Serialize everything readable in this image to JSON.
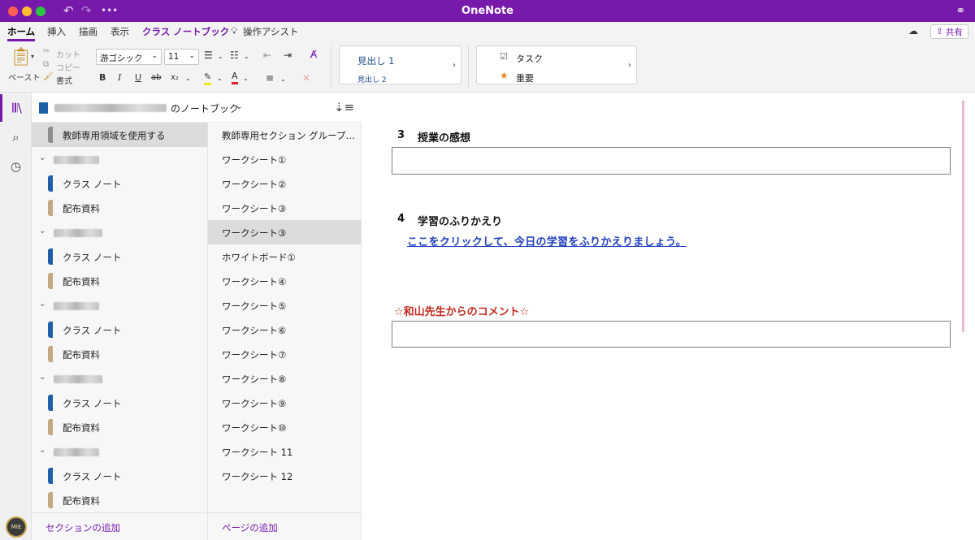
{
  "window": {
    "title": "OneNote"
  },
  "menu_tabs": [
    {
      "label": "ホーム"
    },
    {
      "label": "挿入"
    },
    {
      "label": "描画"
    },
    {
      "label": "表示"
    },
    {
      "label": "クラス ノートブック"
    },
    {
      "label": "操作アシスト"
    }
  ],
  "share": {
    "label": "共有"
  },
  "ribbon": {
    "paste_label": "ペースト",
    "cut_label": "カット",
    "copy_label": "コピー",
    "format_label": "書式",
    "font_name": "游ゴシック",
    "font_size": "11",
    "bold": "B",
    "italic": "I",
    "underline": "U",
    "strike": "ab",
    "subscript": "x₂",
    "styles": {
      "heading1": "見出し 1",
      "heading2": "見出し 2"
    },
    "tags": {
      "task": "タスク",
      "important": "重要"
    }
  },
  "notebook": {
    "title_suffix": "のノートブック"
  },
  "sections": [
    {
      "label": "教師専用領域を使用する",
      "kind": "gray",
      "type": "section",
      "selected": true
    },
    {
      "label": "",
      "type": "group"
    },
    {
      "label": "クラス ノート",
      "kind": "blue",
      "type": "section"
    },
    {
      "label": "配布資料",
      "kind": "tan",
      "type": "section"
    },
    {
      "label": "",
      "type": "group"
    },
    {
      "label": "クラス ノート",
      "kind": "blue",
      "type": "section"
    },
    {
      "label": "配布資料",
      "kind": "tan",
      "type": "section"
    },
    {
      "label": "",
      "type": "group"
    },
    {
      "label": "クラス ノート",
      "kind": "blue",
      "type": "section"
    },
    {
      "label": "配布資料",
      "kind": "tan",
      "type": "section"
    },
    {
      "label": "",
      "type": "group"
    },
    {
      "label": "クラス ノート",
      "kind": "blue",
      "type": "section"
    },
    {
      "label": "配布資料",
      "kind": "tan",
      "type": "section"
    },
    {
      "label": "",
      "type": "group"
    },
    {
      "label": "クラス ノート",
      "kind": "blue",
      "type": "section"
    },
    {
      "label": "配布資料",
      "kind": "tan",
      "type": "section"
    }
  ],
  "pages": [
    {
      "label": "教師専用セクション グループ…"
    },
    {
      "label": "ワークシート①"
    },
    {
      "label": "ワークシート②"
    },
    {
      "label": "ワークシート③"
    },
    {
      "label": "ワークシート③",
      "selected": true
    },
    {
      "label": "ホワイトボード①"
    },
    {
      "label": "ワークシート④"
    },
    {
      "label": "ワークシート⑤"
    },
    {
      "label": "ワークシート⑥"
    },
    {
      "label": "ワークシート⑦"
    },
    {
      "label": "ワークシート⑧"
    },
    {
      "label": "ワークシート⑨"
    },
    {
      "label": "ワークシート⑩"
    },
    {
      "label": "ワークシート 11"
    },
    {
      "label": "ワークシート 12"
    }
  ],
  "footer": {
    "add_section": "セクションの追加",
    "add_page": "ページの追加"
  },
  "content": {
    "q3_number": "3",
    "q3_title": "授業の感想",
    "q4_number": "4",
    "q4_title": "学習のふりかえり",
    "q4_link": "ここをクリックして、今日の学習をふりかえりましょう。",
    "comment_title": "☆和山先生からのコメント☆"
  },
  "colors": {
    "brand": "#7719aa",
    "link": "#1f3fbf",
    "comment": "#c0281c"
  }
}
